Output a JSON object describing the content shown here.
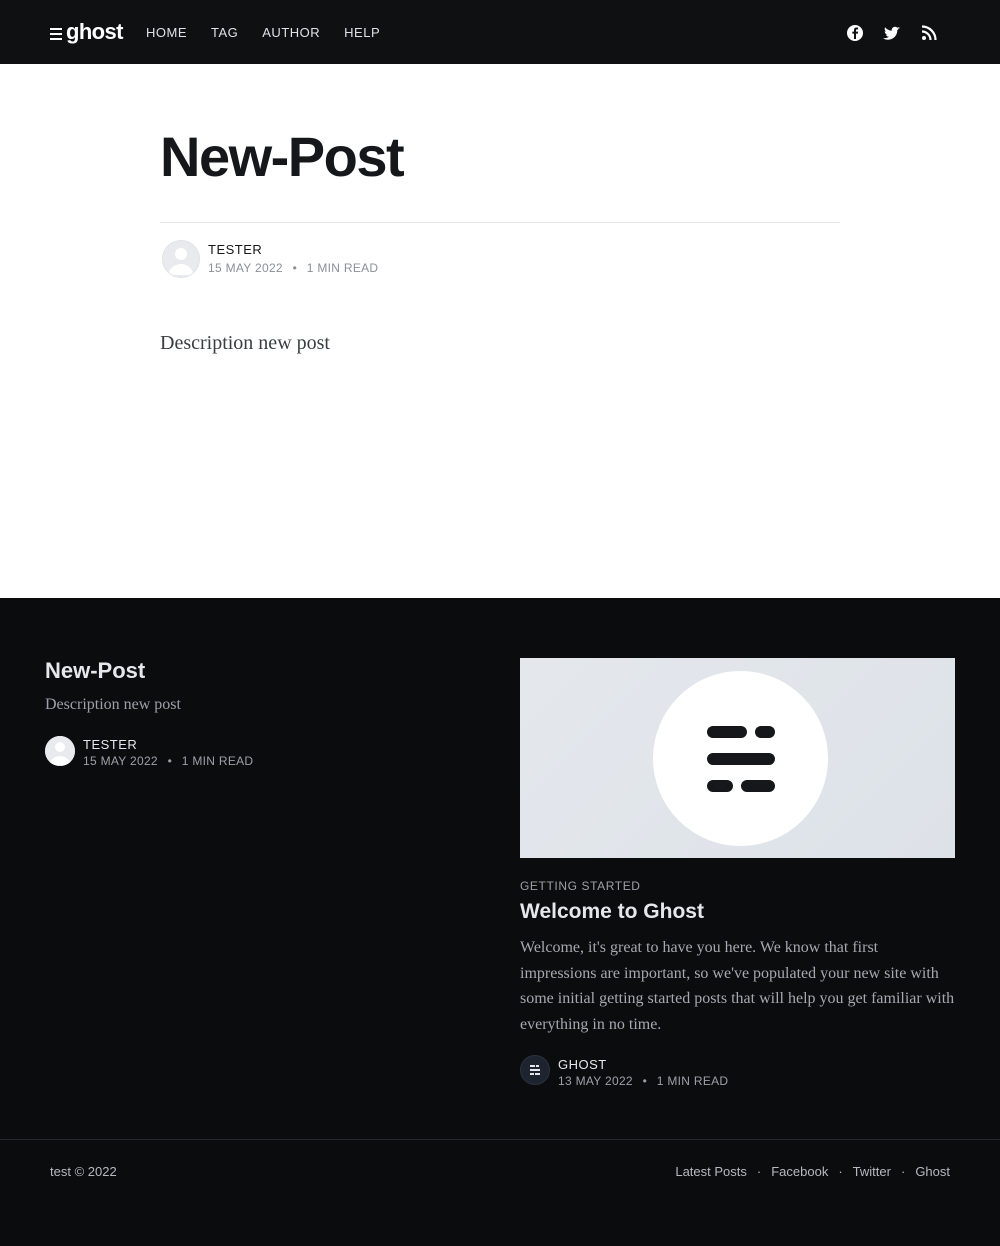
{
  "header": {
    "logo_text": "ghost",
    "nav": [
      "HOME",
      "TAG",
      "AUTHOR",
      "HELP"
    ],
    "social_icons": [
      "facebook-icon",
      "twitter-icon",
      "rss-icon"
    ]
  },
  "post": {
    "title": "New-Post",
    "author": "TESTER",
    "date": "15 MAY 2022",
    "separator": "•",
    "read_time": "1 MIN READ",
    "description": "Description new post"
  },
  "related": {
    "left": {
      "title": "New-Post",
      "description": "Description new post",
      "author": "TESTER",
      "date": "15 MAY 2022",
      "read_time": "1 MIN READ"
    },
    "right": {
      "tag": "GETTING STARTED",
      "title": "Welcome to Ghost",
      "excerpt": "Welcome, it's great to have you here. We know that first impressions are important, so we've populated your new site with some initial getting started posts that will help you get familiar with everything in no time.",
      "author": "GHOST",
      "date": "13 MAY 2022",
      "read_time": "1 MIN READ"
    }
  },
  "footer": {
    "copyright": "test © 2022",
    "links": [
      "Latest Posts",
      "Facebook",
      "Twitter",
      "Ghost"
    ],
    "link_separator": "·"
  },
  "colors": {
    "topbar": "#0f1012",
    "footer_bg": "#0b0c0e",
    "title": "#15171a"
  }
}
